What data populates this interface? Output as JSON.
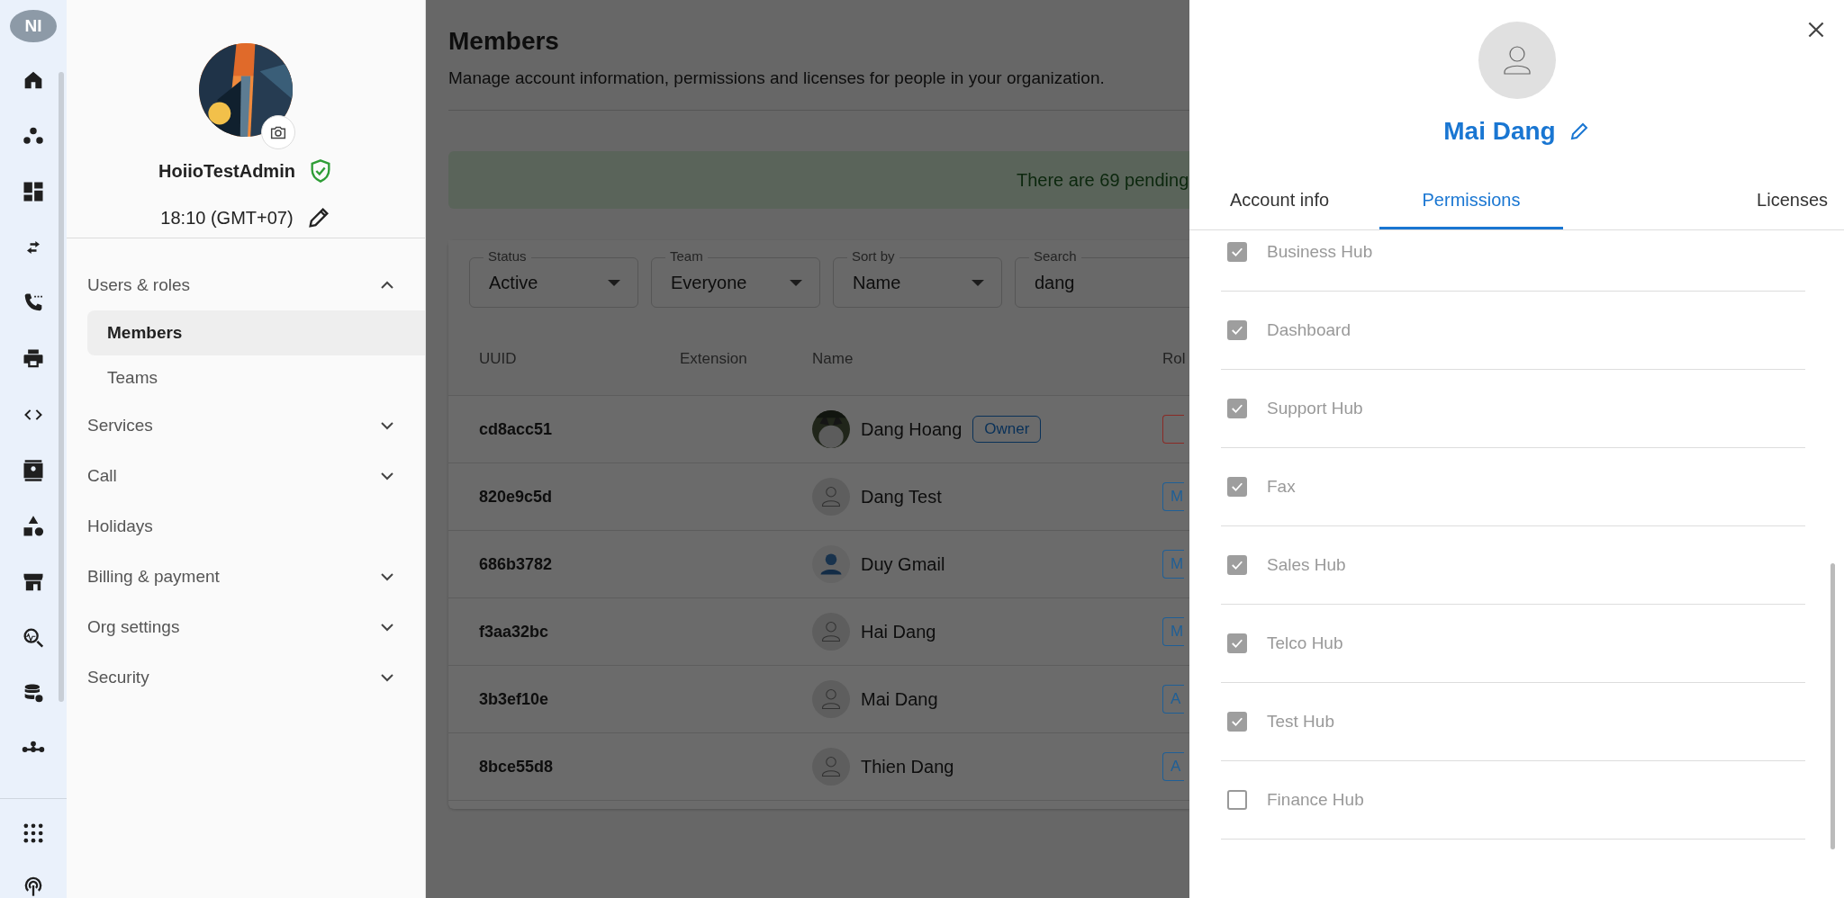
{
  "rail": {
    "avatar": "NI"
  },
  "profile": {
    "name": "HoiioTestAdmin",
    "time": "18:10 (GMT+07)"
  },
  "nav": [
    {
      "label": "Users & roles",
      "kind": "group",
      "expanded": true,
      "children": [
        {
          "label": "Members",
          "selected": true
        },
        {
          "label": "Teams",
          "selected": false
        }
      ]
    },
    {
      "label": "Services",
      "kind": "group",
      "expanded": false
    },
    {
      "label": "Call",
      "kind": "group",
      "expanded": false
    },
    {
      "label": "Holidays",
      "kind": "link"
    },
    {
      "label": "Billing & payment",
      "kind": "group",
      "expanded": false
    },
    {
      "label": "Org settings",
      "kind": "group",
      "expanded": false
    },
    {
      "label": "Security",
      "kind": "group",
      "expanded": false
    }
  ],
  "main": {
    "title": "Members",
    "description": "Manage account information, permissions and licenses for people in your organization.",
    "banner": "There are 69 pending",
    "filters": [
      {
        "label": "Status",
        "value": "Active",
        "kind": "select"
      },
      {
        "label": "Team",
        "value": "Everyone",
        "kind": "select"
      },
      {
        "label": "Sort by",
        "value": "Name",
        "kind": "select"
      },
      {
        "label": "Search",
        "value": "dang",
        "kind": "search"
      }
    ],
    "table": {
      "columns": [
        "UUID",
        "Extension",
        "Name",
        "Rol"
      ],
      "rows": [
        {
          "uuid": "cd8acc51",
          "name": "Dang Hoang",
          "badge": "Owner",
          "role": {
            "color": "#8a2a25"
          }
        },
        {
          "uuid": "820e9c5d",
          "name": "Dang Test",
          "kind": "placeholder",
          "role": {
            "label": "M",
            "color": "#1f5f96"
          }
        },
        {
          "uuid": "686b3782",
          "name": "Duy Gmail",
          "kind": "person",
          "role": {
            "label": "M",
            "color": "#1f5f96"
          }
        },
        {
          "uuid": "f3aa32bc",
          "name": "Hai Dang",
          "kind": "placeholder",
          "role": {
            "label": "M",
            "color": "#1f5f96"
          }
        },
        {
          "uuid": "3b3ef10e",
          "name": "Mai Dang",
          "kind": "placeholder",
          "role": {
            "label": "A",
            "color": "#1f5f96"
          }
        },
        {
          "uuid": "8bce55d8",
          "name": "Thien Dang",
          "kind": "placeholder",
          "role": {
            "label": "A",
            "color": "#1f5f96"
          }
        }
      ]
    }
  },
  "drawer": {
    "name": "Mai Dang",
    "tabs": [
      {
        "label": "Account info",
        "selected": false
      },
      {
        "label": "Permissions",
        "selected": true
      },
      {
        "label": "Licenses",
        "selected": false
      }
    ],
    "permissions": [
      {
        "label": "Business Hub",
        "checked": true
      },
      {
        "label": "Dashboard",
        "checked": true
      },
      {
        "label": "Support Hub",
        "checked": true
      },
      {
        "label": "Fax",
        "checked": true
      },
      {
        "label": "Sales Hub",
        "checked": true
      },
      {
        "label": "Telco Hub",
        "checked": true
      },
      {
        "label": "Test Hub",
        "checked": true
      },
      {
        "label": "Finance Hub",
        "checked": false
      }
    ]
  }
}
